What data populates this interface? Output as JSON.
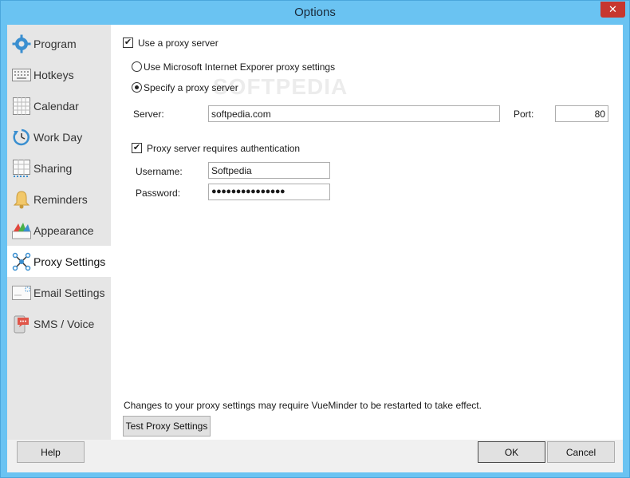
{
  "window": {
    "title": "Options",
    "close_glyph": "✕"
  },
  "colors": {
    "titlebar": "#6ac3f2",
    "close": "#c7372f",
    "sidebar": "#e6e6e6",
    "active": "#ffffff"
  },
  "sidebar": {
    "items": [
      {
        "label": "Program",
        "icon": "gear-icon"
      },
      {
        "label": "Hotkeys",
        "icon": "keyboard-icon"
      },
      {
        "label": "Calendar",
        "icon": "calendar-icon"
      },
      {
        "label": "Work Day",
        "icon": "clock-icon"
      },
      {
        "label": "Sharing",
        "icon": "sharing-icon"
      },
      {
        "label": "Reminders",
        "icon": "bell-icon"
      },
      {
        "label": "Appearance",
        "icon": "palette-icon"
      },
      {
        "label": "Proxy Settings",
        "icon": "network-icon"
      },
      {
        "label": "Email Settings",
        "icon": "envelope-icon"
      },
      {
        "label": "SMS / Voice",
        "icon": "phone-icon"
      }
    ],
    "active_index": 7
  },
  "proxy": {
    "use_proxy_label": "Use a proxy server",
    "use_proxy_checked": true,
    "ie_option_label": "Use Microsoft Internet Exporer proxy settings",
    "specify_option_label": "Specify a proxy server",
    "server_label": "Server:",
    "server_value": "softpedia.com",
    "port_label": "Port:",
    "port_value": "80",
    "auth_label": "Proxy server requires authentication",
    "auth_checked": true,
    "username_label": "Username:",
    "username_value": "Softpedia",
    "password_label": "Password:",
    "password_value": "●●●●●●●●●●●●●●●",
    "restart_note": "Changes to your proxy settings may require VueMinder to be restarted to take effect.",
    "test_button": "Test Proxy Settings"
  },
  "footer": {
    "help": "Help",
    "ok": "OK",
    "cancel": "Cancel"
  },
  "watermark": "SOFTPEDIA"
}
